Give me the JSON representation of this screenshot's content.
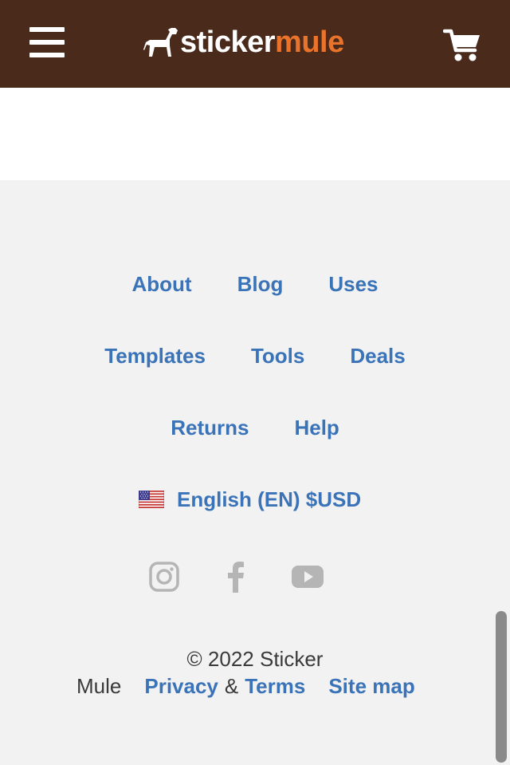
{
  "header": {
    "logo_word_1": "sticker",
    "logo_word_2": "mule",
    "logo_color": "#e9732a",
    "menu_icon": "hamburger-menu-icon",
    "cart_icon": "shopping-cart-icon",
    "background": "#4a2a1b"
  },
  "content": {
    "cut_text": "..."
  },
  "footer": {
    "row1": [
      "About",
      "Blog",
      "Uses"
    ],
    "row2": [
      "Templates",
      "Tools",
      "Deals"
    ],
    "row3": [
      "Returns",
      "Help"
    ],
    "language": "English (EN) $USD",
    "flag_icon": "us-flag-icon",
    "social": [
      "instagram-icon",
      "facebook-icon",
      "youtube-icon"
    ],
    "copyright_1": "© 2022 Sticker",
    "copyright_2": "Mule",
    "privacy": "Privacy",
    "amp": "&",
    "terms": "Terms",
    "sitemap": "Site map",
    "link_color": "#3a73b8"
  }
}
